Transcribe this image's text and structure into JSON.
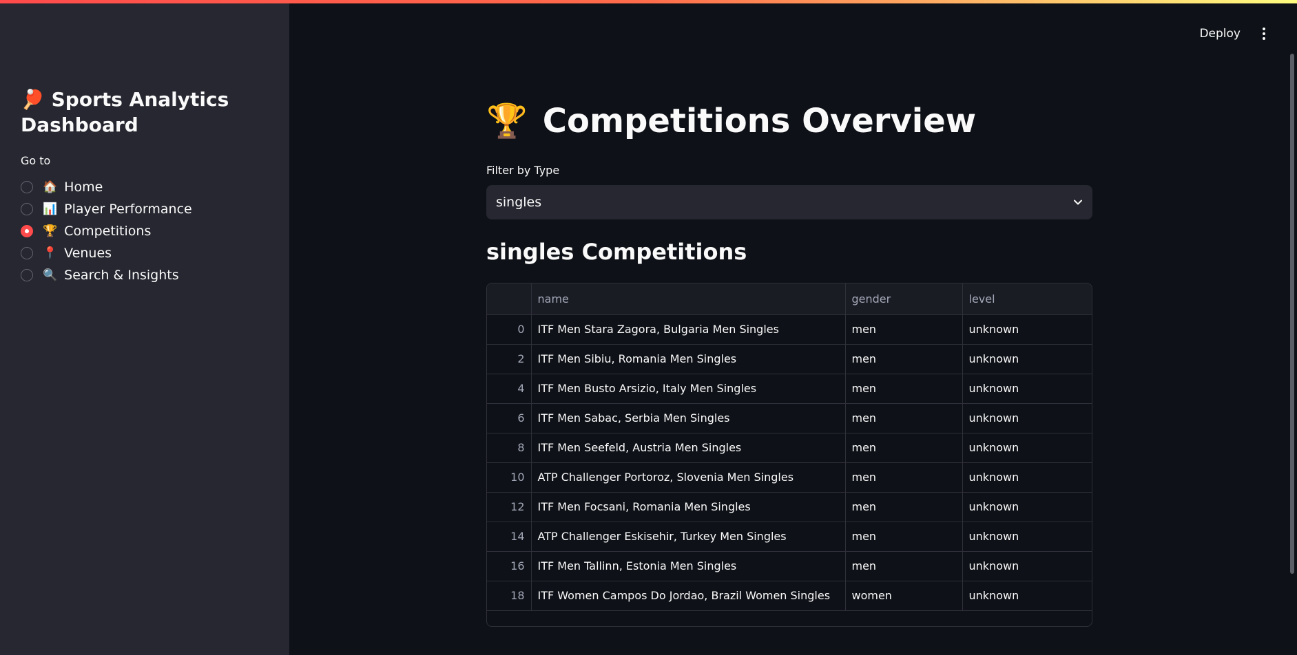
{
  "sidebar": {
    "title_icon": "tennis-racket-icon",
    "title_emoji": "🏓",
    "title": "Sports Analytics Dashboard",
    "nav_label": "Go to",
    "items": [
      {
        "emoji": "🏠",
        "icon": "house-icon",
        "label": "Home",
        "selected": false
      },
      {
        "emoji": "📊",
        "icon": "bar-chart-icon",
        "label": "Player Performance",
        "selected": false
      },
      {
        "emoji": "🏆",
        "icon": "trophy-icon",
        "label": "Competitions",
        "selected": true
      },
      {
        "emoji": "📍",
        "icon": "pin-icon",
        "label": "Venues",
        "selected": false
      },
      {
        "emoji": "🔍",
        "icon": "magnifier-icon",
        "label": "Search & Insights",
        "selected": false
      }
    ]
  },
  "header": {
    "deploy_label": "Deploy",
    "menu_icon": "kebab-menu-icon"
  },
  "main": {
    "title_emoji": "🏆",
    "title": "Competitions Overview",
    "filter_label": "Filter by Type",
    "filter_value": "singles",
    "section_title": "singles Competitions",
    "table": {
      "columns": [
        "",
        "name",
        "gender",
        "level"
      ],
      "rows": [
        [
          "0",
          "ITF Men Stara Zagora, Bulgaria Men Singles",
          "men",
          "unknown"
        ],
        [
          "2",
          "ITF Men Sibiu, Romania Men Singles",
          "men",
          "unknown"
        ],
        [
          "4",
          "ITF Men Busto Arsizio, Italy Men Singles",
          "men",
          "unknown"
        ],
        [
          "6",
          "ITF Men Sabac, Serbia Men Singles",
          "men",
          "unknown"
        ],
        [
          "8",
          "ITF Men Seefeld, Austria Men Singles",
          "men",
          "unknown"
        ],
        [
          "10",
          "ATP Challenger Portoroz, Slovenia Men Singles",
          "men",
          "unknown"
        ],
        [
          "12",
          "ITF Men Focsani, Romania Men Singles",
          "men",
          "unknown"
        ],
        [
          "14",
          "ATP Challenger Eskisehir, Turkey Men Singles",
          "men",
          "unknown"
        ],
        [
          "16",
          "ITF Men Tallinn, Estonia Men Singles",
          "men",
          "unknown"
        ],
        [
          "18",
          "ITF Women Campos Do Jordao, Brazil Women Singles",
          "women",
          "unknown"
        ]
      ]
    }
  },
  "colors": {
    "accent": "#ff4b4b",
    "sidebar_bg": "#262730",
    "main_bg": "#0e1117"
  }
}
